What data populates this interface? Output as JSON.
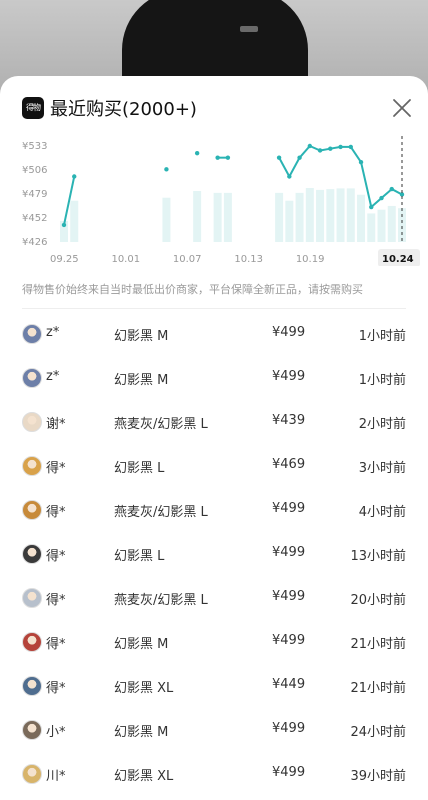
{
  "header": {
    "logo_text": "得物",
    "title": "最近购买(2000+)"
  },
  "chart_data": {
    "type": "line",
    "y_ticks": [
      "¥533",
      "¥506",
      "¥479",
      "¥452",
      "¥426"
    ],
    "x_ticks": [
      "09.25",
      "10.01",
      "10.07",
      "10.13",
      "10.19",
      "10.24"
    ],
    "ylim": [
      426,
      533
    ],
    "series": [
      {
        "values": [
          {
            "day": 0,
            "price": 445
          },
          {
            "day": 1,
            "price": 499
          },
          {
            "day": 10,
            "price": 507
          },
          {
            "day": 13,
            "price": 525
          },
          {
            "day": 15,
            "price": 520
          },
          {
            "day": 16,
            "price": 520
          },
          {
            "day": 21,
            "price": 520
          },
          {
            "day": 22,
            "price": 499
          },
          {
            "day": 23,
            "price": 520
          },
          {
            "day": 24,
            "price": 533
          },
          {
            "day": 25,
            "price": 528
          },
          {
            "day": 26,
            "price": 530
          },
          {
            "day": 27,
            "price": 532
          },
          {
            "day": 28,
            "price": 532
          },
          {
            "day": 29,
            "price": 515
          },
          {
            "day": 30,
            "price": 465
          },
          {
            "day": 31,
            "price": 475
          },
          {
            "day": 32,
            "price": 485
          },
          {
            "day": 33,
            "price": 479
          }
        ]
      }
    ],
    "highlight_x": "10.24",
    "accent_color": "#2ab3b3"
  },
  "disclaimer": "得物售价始终来自当时最低出价商家，平台保障全新正品，请按需购买",
  "purchases": [
    {
      "user": "z*",
      "product": "幻影黑 M",
      "price": "¥499",
      "time": "1小时前",
      "avatar_color": "#6d7fa8"
    },
    {
      "user": "z*",
      "product": "幻影黑 M",
      "price": "¥499",
      "time": "1小时前",
      "avatar_color": "#6d7fa8"
    },
    {
      "user": "谢*",
      "product": "燕麦灰/幻影黑 L",
      "price": "¥439",
      "time": "2小时前",
      "avatar_color": "#e9d9c6"
    },
    {
      "user": "得*",
      "product": "幻影黑 L",
      "price": "¥469",
      "time": "3小时前",
      "avatar_color": "#d9a24a"
    },
    {
      "user": "得*",
      "product": "燕麦灰/幻影黑 L",
      "price": "¥499",
      "time": "4小时前",
      "avatar_color": "#c78a3a"
    },
    {
      "user": "得*",
      "product": "幻影黑 L",
      "price": "¥499",
      "time": "13小时前",
      "avatar_color": "#3a3a3a"
    },
    {
      "user": "得*",
      "product": "燕麦灰/幻影黑 L",
      "price": "¥499",
      "time": "20小时前",
      "avatar_color": "#b7c0cc"
    },
    {
      "user": "得*",
      "product": "幻影黑 M",
      "price": "¥499",
      "time": "21小时前",
      "avatar_color": "#b5433a"
    },
    {
      "user": "得*",
      "product": "幻影黑 XL",
      "price": "¥449",
      "time": "21小时前",
      "avatar_color": "#4f6d8f"
    },
    {
      "user": "小*",
      "product": "幻影黑 M",
      "price": "¥499",
      "time": "24小时前",
      "avatar_color": "#7a6a5a"
    },
    {
      "user": "川*",
      "product": "幻影黑 XL",
      "price": "¥499",
      "time": "39小时前",
      "avatar_color": "#d8b46a"
    }
  ]
}
